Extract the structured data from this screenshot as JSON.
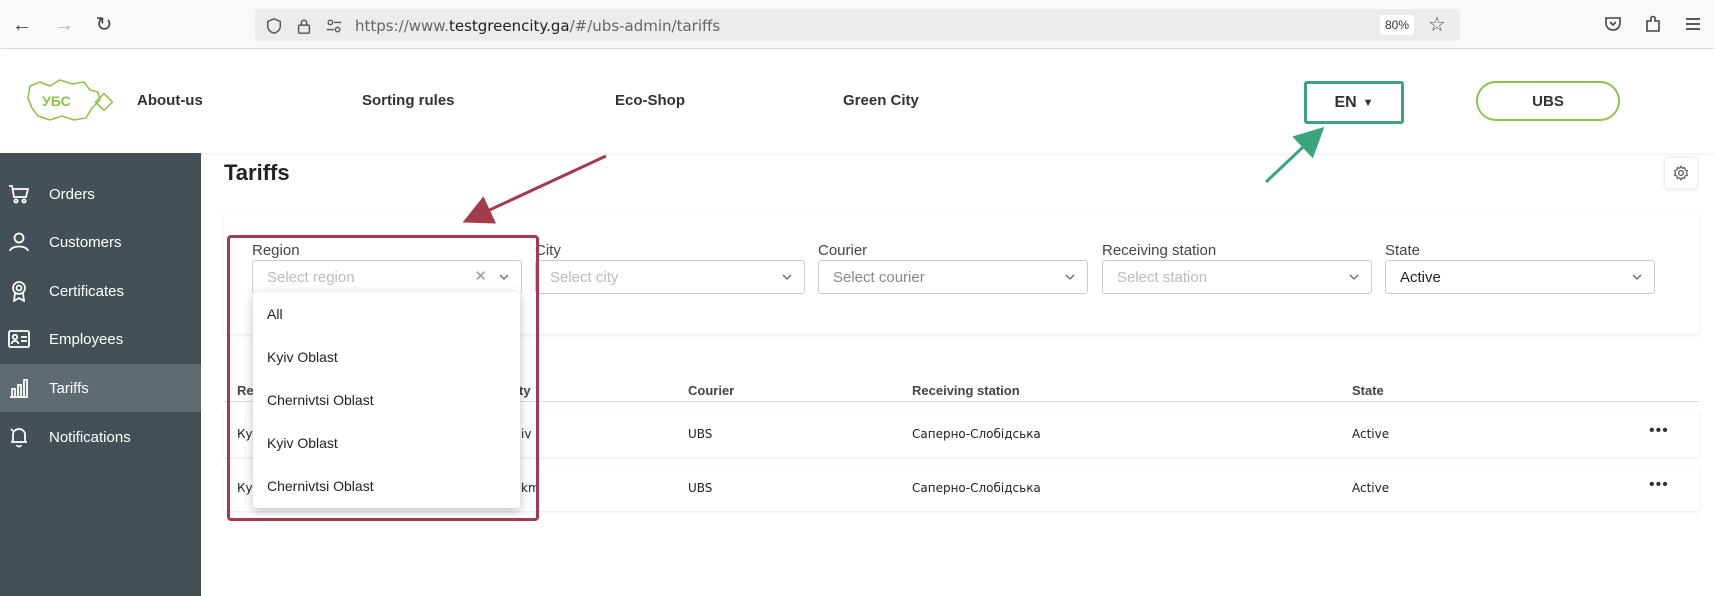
{
  "browser": {
    "url_prefix": "https://www.",
    "url_domain": "testgreencity.ga",
    "url_path": "/#/ubs-admin/tariffs",
    "zoom": "80%"
  },
  "header": {
    "logo_text": "УБС",
    "nav": [
      "About-us",
      "Sorting rules",
      "Eco-Shop",
      "Green City"
    ],
    "language": "EN",
    "ubs_button": "UBS",
    "accent_color": "#3aa47c"
  },
  "sidebar": {
    "items": [
      {
        "label": "Orders",
        "icon": "cart-icon"
      },
      {
        "label": "Customers",
        "icon": "person-icon"
      },
      {
        "label": "Certificates",
        "icon": "certificate-icon"
      },
      {
        "label": "Employees",
        "icon": "id-card-icon"
      },
      {
        "label": "Tariffs",
        "icon": "chart-icon"
      },
      {
        "label": "Notifications",
        "icon": "bell-icon"
      }
    ],
    "active": "Tariffs"
  },
  "page": {
    "title": "Tariffs"
  },
  "filters": {
    "region": {
      "label": "Region",
      "placeholder": "Select region"
    },
    "city": {
      "label": "City",
      "placeholder": "Select city"
    },
    "courier": {
      "label": "Courier",
      "placeholder": "Select courier"
    },
    "station": {
      "label": "Receiving station",
      "placeholder": "Select station"
    },
    "state": {
      "label": "State",
      "value": "Active"
    }
  },
  "region_dropdown": {
    "options": [
      "All",
      "Kyiv Oblast",
      "Chernivtsi Oblast",
      "Kyiv Oblast",
      "Chernivtsi Oblast"
    ]
  },
  "table": {
    "columns": [
      "Re",
      "ty",
      "Courier",
      "Receiving station",
      "State"
    ],
    "rows": [
      {
        "region": "Ку",
        "city": "iv",
        "courier": "UBS",
        "station": "Саперно-Слобідська",
        "state": "Active"
      },
      {
        "region": "Ку",
        "city": "km",
        "courier": "UBS",
        "station": "Саперно-Слобідська",
        "state": "Active"
      }
    ]
  }
}
